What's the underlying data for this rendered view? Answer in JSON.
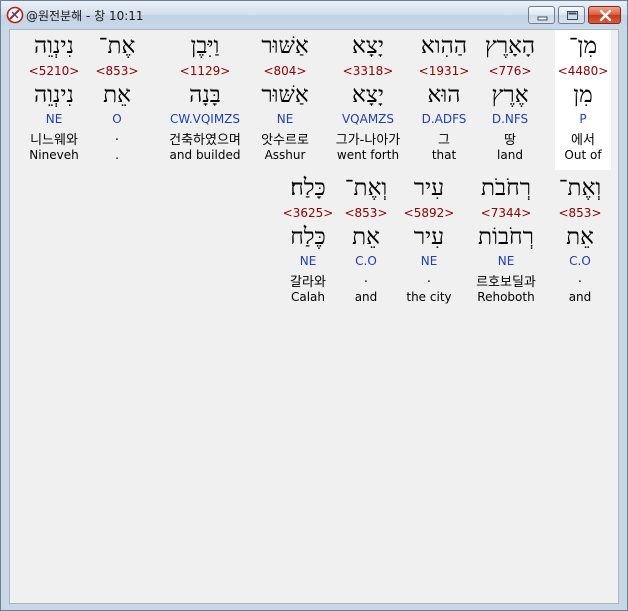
{
  "window": {
    "title": "@원전분해 - 창 10:11",
    "icon": "bible-app-icon"
  },
  "controls": {
    "minimize": "minimize-icon",
    "maximize": "maximize-icon",
    "close": "close-icon"
  },
  "colors": {
    "strong": "#8b0000",
    "morph": "#1f3fb0",
    "highlight": "#ffffff",
    "background": "#f0f0f0"
  },
  "rows": [
    {
      "words": [
        {
          "heb": "מִן־",
          "strong": "<4480>",
          "lex": "מִן",
          "morph": "P",
          "kor": "에서",
          "eng": "Out of",
          "highlight": true
        },
        {
          "heb": "הָאָרֶץ",
          "strong": "<776>",
          "lex": "אֶרֶץ",
          "morph": "D.NFS",
          "kor": "땅",
          "eng": "land"
        },
        {
          "heb": "הַהִוא",
          "strong": "<1931>",
          "lex": "הוּא",
          "morph": "D.ADFS",
          "kor": "그",
          "eng": "that"
        },
        {
          "heb": "יָצָא",
          "strong": "<3318>",
          "lex": "יָצָא",
          "morph": "VQAMZS",
          "kor": "그가-나아가",
          "eng": "went forth"
        },
        {
          "heb": "אַשּׁוּר",
          "strong": "<804>",
          "lex": "אַשּׁוּר",
          "morph": "NE",
          "kor": "앗수르로",
          "eng": "Asshur"
        },
        {
          "heb": "וַיִּבֶן",
          "strong": "<1129>",
          "lex": "בָּנָה",
          "morph": "CW.VQIMZS",
          "kor": "건축하였으며",
          "eng": "and builded"
        },
        {
          "heb": "אֶת־",
          "strong": "<853>",
          "lex": "אֵת",
          "morph": "O",
          "kor": ".",
          "eng": "."
        },
        {
          "heb": "נִינְוֵה",
          "strong": "<5210>",
          "lex": "נִינְוֵה",
          "morph": "NE",
          "kor": "니느웨와",
          "eng": "Nineveh"
        }
      ]
    },
    {
      "words": [
        {
          "heb": "וְאֶת־",
          "strong": "<853>",
          "lex": "אֵת",
          "morph": "C.O",
          "kor": ".",
          "eng": "and"
        },
        {
          "heb": "רְחֹבֹת",
          "strong": "<7344>",
          "lex": "רְחֹבוֹת",
          "morph": "NE",
          "kor": "르호보딜과",
          "eng": "Rehoboth"
        },
        {
          "heb": "עִיר",
          "strong": "<5892>",
          "lex": "עִיר",
          "morph": "NE",
          "kor": ".",
          "eng": "the city"
        },
        {
          "heb": "וְאֶת־",
          "strong": "<853>",
          "lex": "אֵת",
          "morph": "C.O",
          "kor": ".",
          "eng": "and"
        },
        {
          "heb": "כָּלַח׃",
          "strong": "<3625>",
          "lex": "כֶּלַח",
          "morph": "NE",
          "kor": "갈라와",
          "eng": "Calah"
        }
      ]
    }
  ]
}
